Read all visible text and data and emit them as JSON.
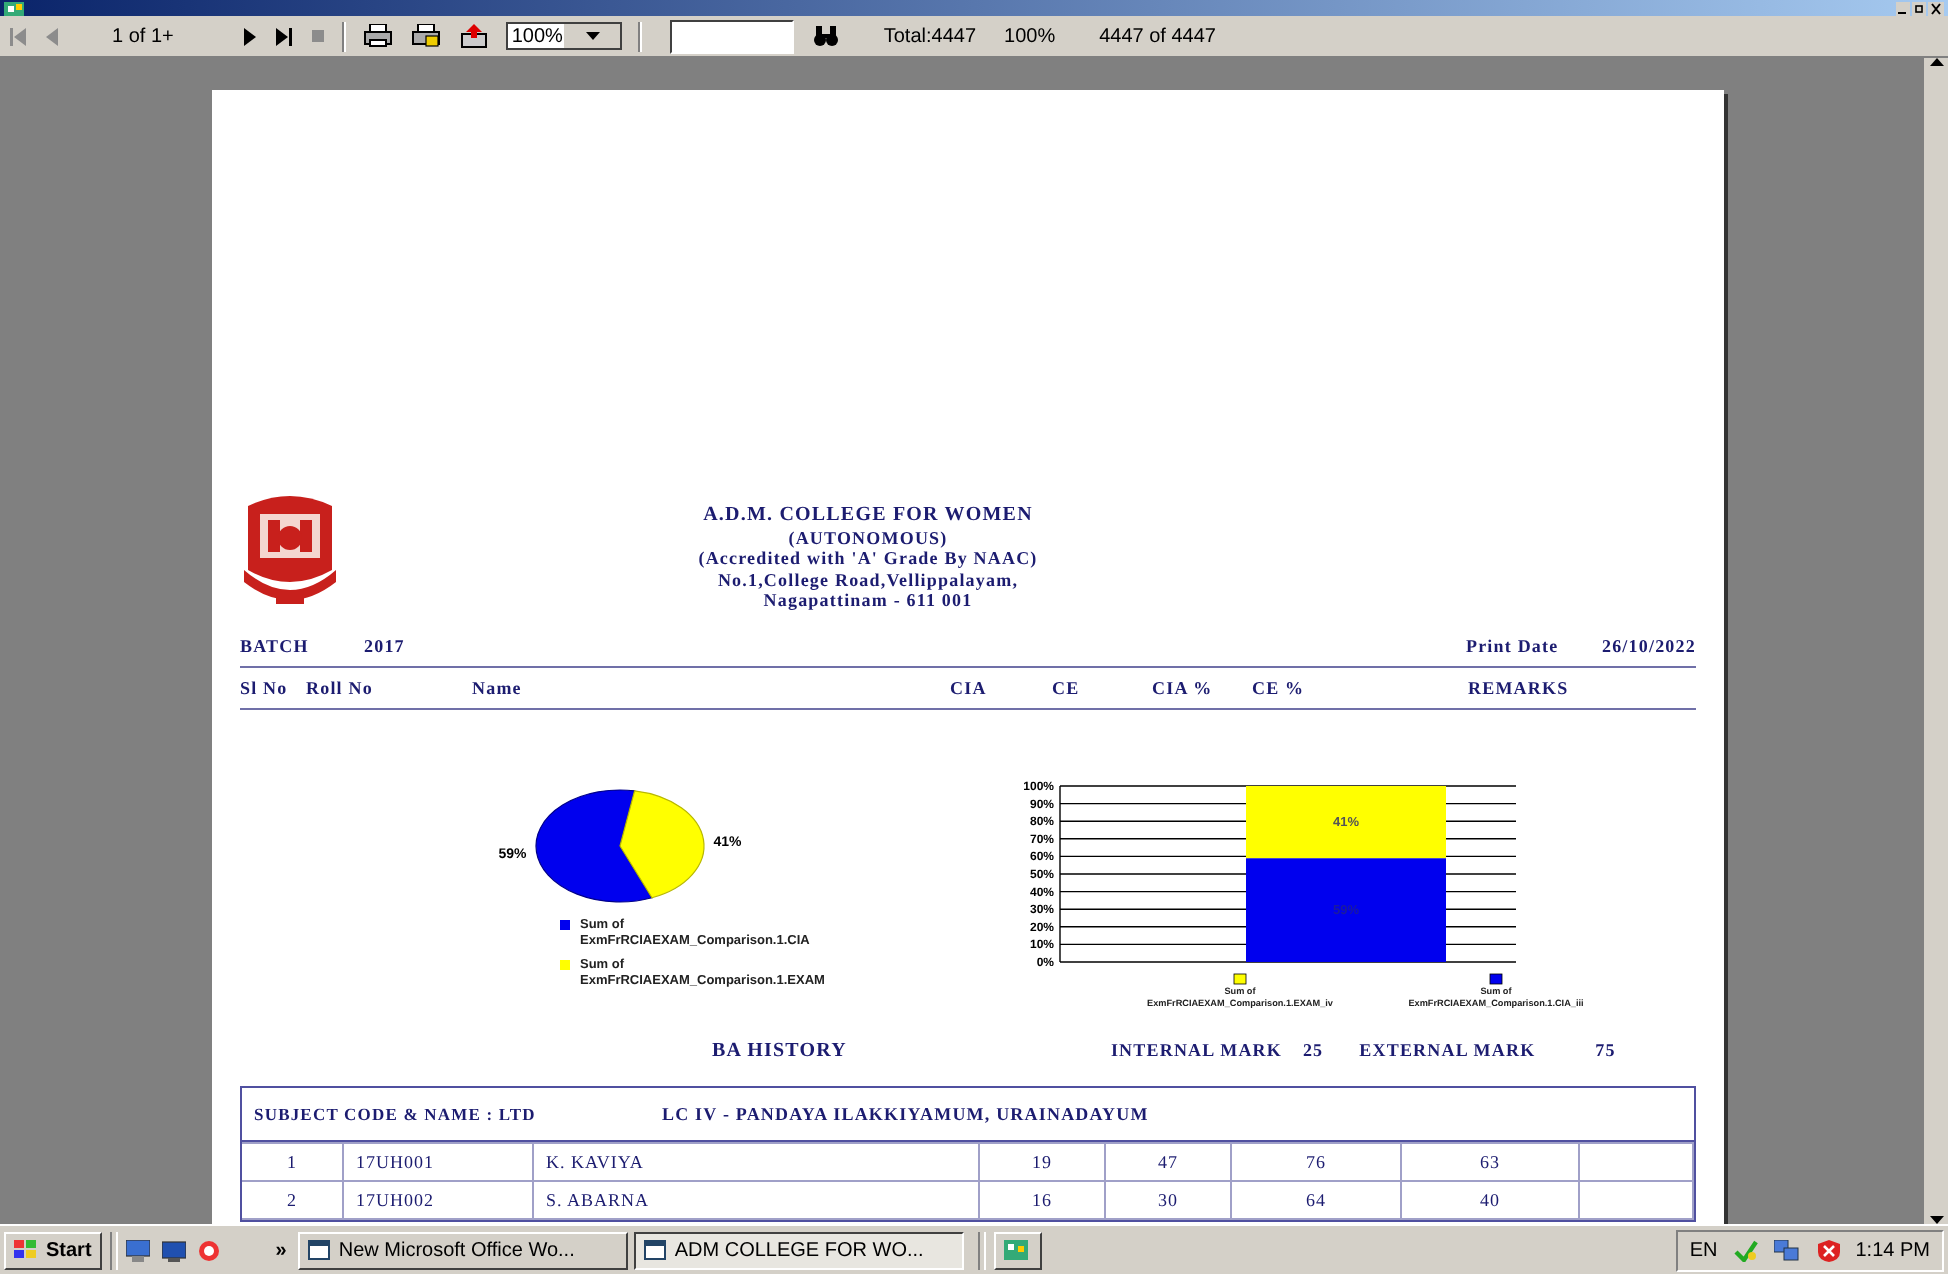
{
  "toolbar": {
    "nav_back": [
      {
        "kind": "first",
        "disabled": true
      },
      {
        "kind": "prev",
        "disabled": true
      }
    ],
    "page_indicator": "1 of 1+",
    "nav_forward": [
      {
        "kind": "next",
        "disabled": false
      },
      {
        "kind": "last",
        "disabled": false
      },
      {
        "kind": "stop",
        "disabled": true
      }
    ],
    "tools": [
      {
        "kind": "print"
      },
      {
        "kind": "print_setup"
      },
      {
        "kind": "export"
      }
    ],
    "zoom": "100%",
    "total": "Total:4447",
    "percent": "100%",
    "record_count": "4447 of 4447"
  },
  "report": {
    "institution": [
      "A.D.M. COLLEGE FOR WOMEN",
      "(AUTONOMOUS)",
      "(Accredited with 'A' Grade By NAAC)",
      "No.1,College Road,Vellippalayam,",
      "Nagapattinam - 611 001"
    ],
    "batch_label": "BATCH",
    "batch": "2017",
    "print_date_label": "Print Date",
    "print_date": "26/10/2022",
    "columns": [
      "Sl No",
      "Roll No",
      "Name",
      "CIA",
      "CE",
      "CIA %",
      "CE %",
      "REMARKS"
    ],
    "pie_chart": {
      "chart_data": {
        "type": "pie",
        "categories": [
          "Sum of ExmFrRCIAEXAM_Comparison.1.CIA",
          "Sum of ExmFrRCIAEXAM_Comparison.1.EXAM"
        ],
        "values": [
          59,
          41
        ],
        "value_labels": [
          "59%",
          "41%"
        ],
        "legend": "bottom"
      }
    },
    "bar_chart": {
      "chart_data": {
        "type": "bar",
        "stacked": true,
        "grid": true,
        "legend": "bottom",
        "ylim": [
          0,
          100
        ],
        "yticks": [
          {
            "value": 0,
            "label": "0%"
          },
          {
            "value": 10,
            "label": "10%"
          },
          {
            "value": 20,
            "label": "20%"
          },
          {
            "value": 30,
            "label": "30%"
          },
          {
            "value": 40,
            "label": "40%"
          },
          {
            "value": 50,
            "label": "50%"
          },
          {
            "value": 60,
            "label": "60%"
          },
          {
            "value": 70,
            "label": "70%"
          },
          {
            "value": 80,
            "label": "80%"
          },
          {
            "value": 90,
            "label": "90%"
          },
          {
            "value": 100,
            "label": "100%"
          }
        ],
        "series": [
          {
            "name": "Sum of ExmFrRCIAEXAM_Comparison.1.CIA_iii",
            "color": "#0000ee",
            "values": [
              59
            ]
          },
          {
            "name": "Sum of ExmFrRCIAEXAM_Comparison.1.EXAM_iv",
            "color": "#ffff00",
            "values": [
              41
            ]
          }
        ],
        "value_labels": [
          "59%",
          "41%"
        ]
      }
    },
    "programme": "BA HISTORY",
    "internal_label": "INTERNAL MARK",
    "internal": "25",
    "external_label": "EXTERNAL MARK",
    "external": "75",
    "subject_label": "SUBJECT CODE & NAME : LTD",
    "subject_name": "LC IV - PANDAYA ILAKKIYAMUM, URAINADAYUM",
    "rows": [
      {
        "sl_no": "1",
        "roll_no": "17UH001",
        "name": "K. KAVIYA",
        "cia": "19",
        "ce": "47",
        "cia_pct": "76",
        "ce_pct": "63"
      },
      {
        "sl_no": "2",
        "roll_no": "17UH002",
        "name": "S. ABARNA",
        "cia": "16",
        "ce": "30",
        "cia_pct": "64",
        "ce_pct": "40"
      }
    ]
  },
  "taskbar": {
    "start": "Start",
    "overflow": "»",
    "tasks": [
      {
        "label": "New Microsoft Office Wo...",
        "selected": false
      },
      {
        "label": "ADM COLLEGE FOR WO...",
        "selected": true
      }
    ],
    "language": "EN",
    "clock": "1:14 PM"
  }
}
